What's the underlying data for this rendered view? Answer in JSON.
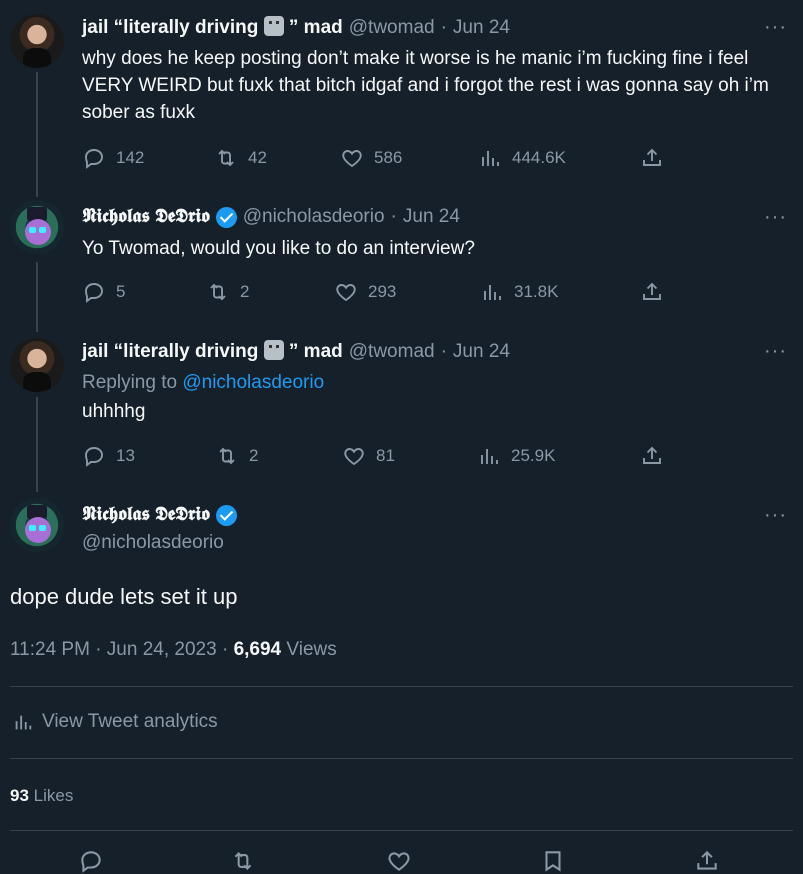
{
  "tweets": [
    {
      "name_a": "jail “literally driving",
      "name_b": "” mad",
      "handle": "@twomad",
      "sep": "·",
      "date": "Jun 24",
      "text": "why does he keep posting don’t make it worse is he manic i’m fucking fine i feel VERY WEIRD but fuxk that bitch idgaf and i forgot the rest i was gonna say oh i’m sober as fuxk",
      "replies": "142",
      "retweets": "42",
      "likes": "586",
      "views": "444.6K"
    },
    {
      "name": "𝕹𝖎𝖈𝖍𝖔𝖑𝖆𝖘 𝕯𝖊𝕯𝖗𝖎𝖔",
      "handle": "@nicholasdeorio",
      "sep": "·",
      "date": "Jun 24",
      "text": "Yo Twomad, would you like to do an interview?",
      "replies": "5",
      "retweets": "2",
      "likes": "293",
      "views": "31.8K"
    },
    {
      "name_a": "jail “literally driving",
      "name_b": "” mad",
      "handle": "@twomad",
      "sep": "·",
      "date": "Jun 24",
      "replying_prefix": "Replying to",
      "replying_to": "@nicholasdeorio",
      "text": "uhhhhg",
      "replies": "13",
      "retweets": "2",
      "likes": "81",
      "views": "25.9K"
    }
  ],
  "main": {
    "name": "𝕹𝖎𝖈𝖍𝖔𝖑𝖆𝖘 𝕯𝖊𝕯𝖗𝖎𝖔",
    "handle": "@nicholasdeorio",
    "text": "dope dude lets set it up",
    "timestamp": "11:24 PM · Jun 24, 2023 ·",
    "views_count": "6,694",
    "views_label": "Views",
    "analytics_label": "View Tweet analytics",
    "likes_count": "93",
    "likes_label": "Likes"
  },
  "more_label": "···",
  "icons": {
    "reply": "reply-icon",
    "retweet": "retweet-icon",
    "like": "heart-icon",
    "views": "views-icon",
    "share": "share-icon",
    "analytics": "analytics-icon",
    "verified": "verified-badge-icon",
    "emoji": "moai-emoji-icon"
  },
  "colors": {
    "background": "#15202b",
    "text": "#f7f9f9",
    "muted": "#8b98a5",
    "link": "#1d9bf0",
    "divider": "#38444d"
  }
}
